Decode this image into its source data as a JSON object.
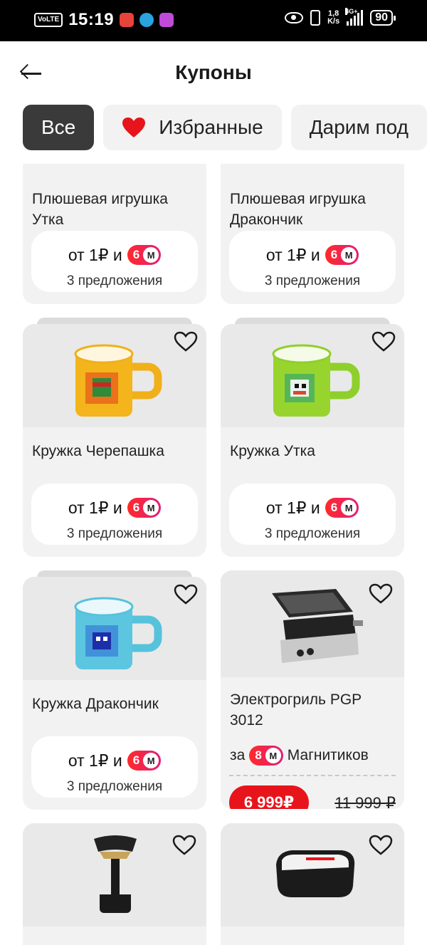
{
  "status_bar": {
    "volte": "VoLTE",
    "time": "15:19",
    "net_speed_value": "1,8",
    "net_speed_unit": "K/s",
    "network": "4G+",
    "battery": "90"
  },
  "header": {
    "title": "Купоны"
  },
  "tabs": [
    {
      "label": "Все",
      "active": true
    },
    {
      "label": "Избранные",
      "icon": "heart-icon"
    },
    {
      "label": "Дарим под"
    }
  ],
  "products": [
    {
      "name": "Плюшевая игрушка Утка",
      "price_prefix": "от 1₽ и",
      "badge": "6",
      "badge_letter": "М",
      "offers": "3 предложения"
    },
    {
      "name": "Плюшевая игрушка Дракончик",
      "price_prefix": "от 1₽ и",
      "badge": "6",
      "badge_letter": "М",
      "offers": "3 предложения"
    },
    {
      "name": "Кружка Черепашка",
      "price_prefix": "от 1₽ и",
      "badge": "6",
      "badge_letter": "М",
      "offers": "3 предложения",
      "image": "mug-yellow"
    },
    {
      "name": "Кружка Утка",
      "price_prefix": "от 1₽ и",
      "badge": "6",
      "badge_letter": "М",
      "offers": "3 предложения",
      "image": "mug-green"
    },
    {
      "name": "Кружка Дракончик",
      "price_prefix": "от 1₽ и",
      "badge": "6",
      "badge_letter": "М",
      "offers": "3 предложения",
      "image": "mug-blue"
    },
    {
      "name": "Электрогриль PGP 3012",
      "magnit_prefix": "за",
      "badge": "8",
      "badge_letter": "М",
      "magnit_suffix": "Магнитиков",
      "sale_price": "6 999₽",
      "old_price": "11 999 ₽",
      "image": "electric-grill"
    },
    {
      "name": "",
      "image": "garment-steamer"
    },
    {
      "name": "",
      "image": "sandwich-maker"
    }
  ],
  "colors": {
    "accent": "#e8141b",
    "tab_active": "#3a3a3a",
    "card_bg": "#f2f2f2"
  }
}
